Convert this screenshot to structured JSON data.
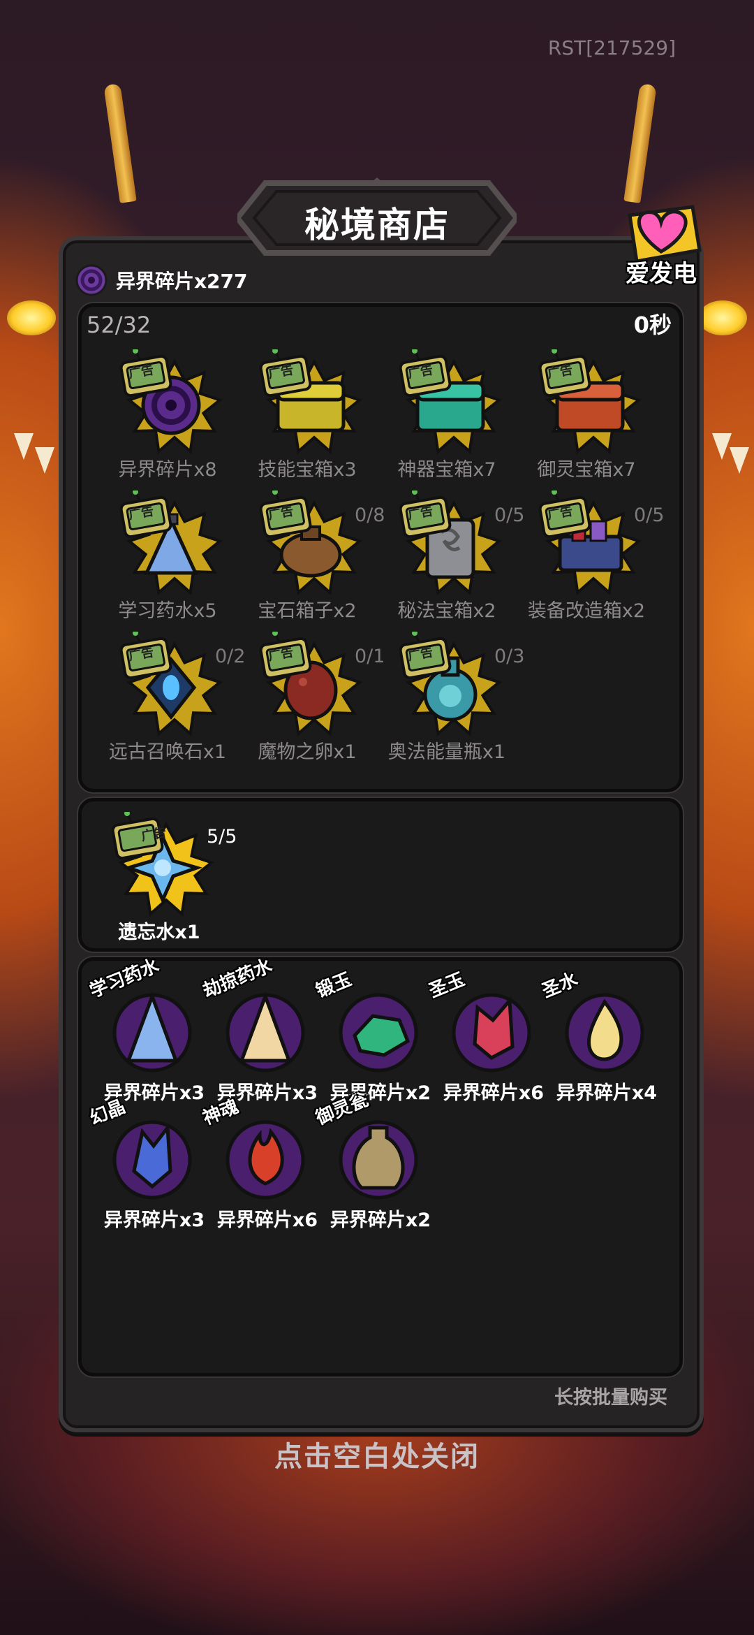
{
  "debug_tag": "RST[217529]",
  "shop": {
    "title": "秘境商店",
    "charge_label": "爱发电",
    "currency": "异界碎片x277",
    "stock_count": "52/32",
    "timer": "0秒",
    "ad_badge": "广告",
    "ad_items": [
      {
        "label": "异界碎片x8",
        "limit": "",
        "icon": "dark-vortex-icon"
      },
      {
        "label": "技能宝箱x3",
        "limit": "",
        "icon": "yellow-chest-icon"
      },
      {
        "label": "神器宝箱x7",
        "limit": "",
        "icon": "teal-chest-icon"
      },
      {
        "label": "御灵宝箱x7",
        "limit": "",
        "icon": "red-chest-icon"
      },
      {
        "label": "学习药水x5",
        "limit": "",
        "icon": "blue-potion-icon"
      },
      {
        "label": "宝石箱子x2",
        "limit": "0/8",
        "icon": "gem-sack-icon"
      },
      {
        "label": "秘法宝箱x2",
        "limit": "0/5",
        "icon": "stone-tablet-icon"
      },
      {
        "label": "装备改造箱x2",
        "limit": "0/5",
        "icon": "gear-crate-icon"
      },
      {
        "label": "远古召唤石x1",
        "limit": "0/2",
        "icon": "summon-stone-icon"
      },
      {
        "label": "魔物之卵x1",
        "limit": "0/1",
        "icon": "monster-egg-icon"
      },
      {
        "label": "奥法能量瓶x1",
        "limit": "0/3",
        "icon": "arcane-flask-icon"
      }
    ],
    "special_item": {
      "label": "遗忘水x1",
      "limit": "5/5",
      "icon": "forget-water-icon"
    },
    "shop_items": [
      {
        "name": "学习药水",
        "price": "异界碎片x3",
        "icon": "study-potion-icon"
      },
      {
        "name": "劫掠药水",
        "price": "异界碎片x3",
        "icon": "plunder-potion-icon"
      },
      {
        "name": "锻玉",
        "price": "异界碎片x2",
        "icon": "jade-icon"
      },
      {
        "name": "圣玉",
        "price": "异界碎片x6",
        "icon": "holy-jade-icon"
      },
      {
        "name": "圣水",
        "price": "异界碎片x4",
        "icon": "holy-water-icon"
      },
      {
        "name": "幻晶",
        "price": "异界碎片x3",
        "icon": "phantom-crystal-icon"
      },
      {
        "name": "神魂",
        "price": "异界碎片x6",
        "icon": "divine-soul-icon"
      },
      {
        "name": "御灵瓮",
        "price": "异界碎片x2",
        "icon": "spirit-urn-icon"
      }
    ],
    "batch_hint": "长按批量购买",
    "close_hint": "点击空白处关闭"
  }
}
